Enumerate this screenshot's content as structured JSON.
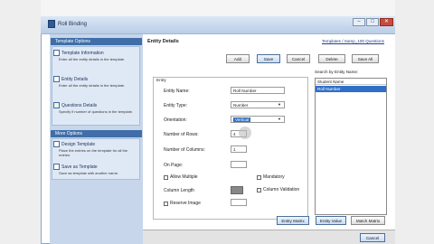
{
  "window": {
    "title": "Roll Binding"
  },
  "left_panel": {
    "template_options_label": "Template Options",
    "items": [
      {
        "title": "Template Information",
        "desc": "Enter all the entity details in the template."
      },
      {
        "title": "Entity Details",
        "desc": "Enter all the entity details in the template."
      },
      {
        "title": "Questions Details",
        "desc": "Specify if number of questions in the template."
      }
    ],
    "more_options_label": "More Options",
    "more_items": [
      {
        "title": "Design Template",
        "desc": "Place the entries on the template for all the entries."
      },
      {
        "title": "Save as Template",
        "desc": "Save as template with another name."
      }
    ]
  },
  "main": {
    "heading": "Entity Details",
    "link_text": "Templates / Samp_100 Questions",
    "toolbar": {
      "add": "Add",
      "save": "Save",
      "cancel": "Cancel",
      "delete": "Delete",
      "save_all": "Save All"
    },
    "entry_box_label": "Entry",
    "fields": {
      "entity_name_label": "Entity Name:",
      "entity_name_value": "Roll Number",
      "entity_type_label": "Entity Type:",
      "entity_type_value": "Number",
      "orientation_label": "Orientation:",
      "orientation_value": "Vertical",
      "rows_label": "Number of Rows:",
      "rows_value": "4",
      "columns_label": "Number of Columns:",
      "columns_value": "1",
      "on_page_label": "On Page:",
      "on_page_value": "",
      "allow_multiple_label": "Allow Multiple",
      "mandatory_label": "Mandatory",
      "column_length_label": "Column Length",
      "column_validation_label": "Column Validation",
      "reserve_image_label": "Reserve Image"
    },
    "search_label": "Search by Entity Name:",
    "list_header": "Student Name",
    "list_selected": "Roll Number",
    "bottom_buttons": {
      "entity_matrix": "Entity Matrix",
      "entity_value": "Entity Value",
      "match_matrix": "Match Matrix"
    },
    "cancel_label": "Cancel"
  },
  "colors": {
    "accent": "#3f6ea8",
    "panel": "#c7d6ea",
    "selection": "#2f6fc7"
  }
}
